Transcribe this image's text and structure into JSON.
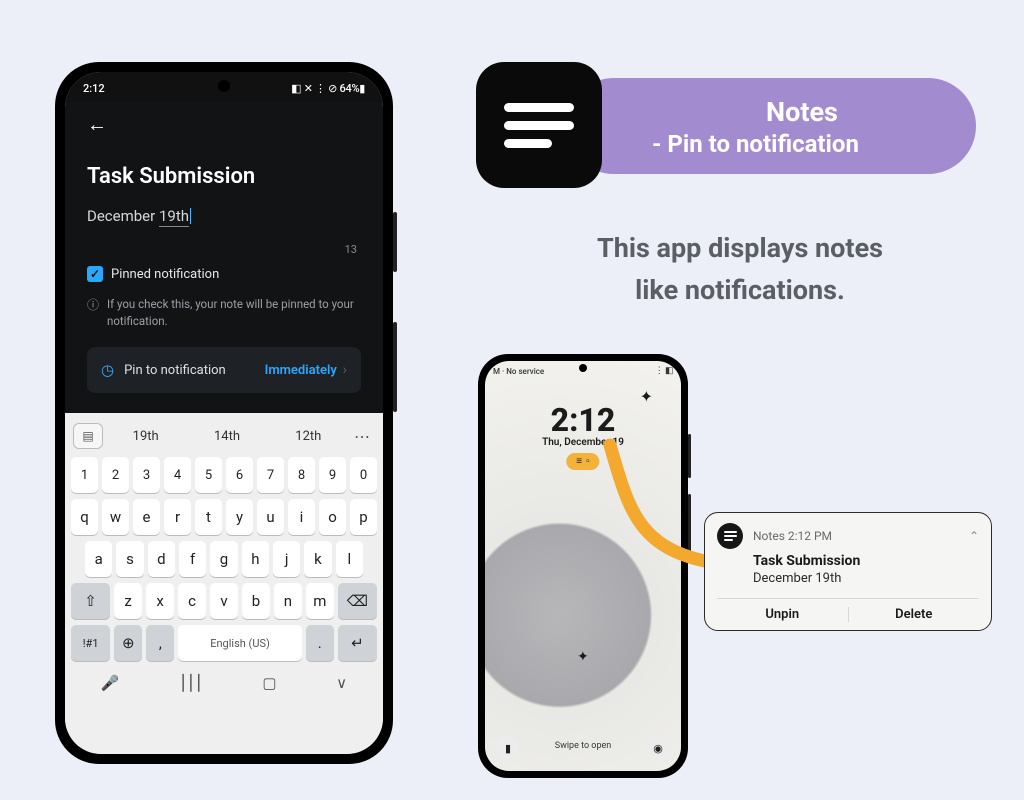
{
  "badge": {
    "line1": "Notes",
    "line2": "- Pin to notification"
  },
  "tagline_line1": "This app displays notes",
  "tagline_line2": "like notifications.",
  "phone_left": {
    "status": {
      "time": "2:12",
      "indicators": "◧ ✕ ⋮ ⊘ 64%▮"
    },
    "note": {
      "title": "Task Submission",
      "body_prefix": "December ",
      "body_underlined": "19th",
      "char_count": "13",
      "checkbox_label": "Pinned notification",
      "hint": "If you check this, your note will be pinned to your notification.",
      "pin_label": "Pin to notification",
      "pin_when": "Immediately"
    },
    "keyboard": {
      "suggestions": [
        "19th",
        "14th",
        "12th"
      ],
      "row_num": [
        "1",
        "2",
        "3",
        "4",
        "5",
        "6",
        "7",
        "8",
        "9",
        "0"
      ],
      "row1": [
        "q",
        "w",
        "e",
        "r",
        "t",
        "y",
        "u",
        "i",
        "o",
        "p"
      ],
      "row2": [
        "a",
        "s",
        "d",
        "f",
        "g",
        "h",
        "j",
        "k",
        "l"
      ],
      "row3": [
        "z",
        "x",
        "c",
        "v",
        "b",
        "n",
        "m"
      ],
      "shift": "⇧",
      "backspace": "⌫",
      "sym": "!#1",
      "globe": "⊕",
      "comma": ",",
      "space_label": "English (US)",
      "period": ".",
      "enter": "↵",
      "nav": {
        "mic": "🎤",
        "recents": "⎮⎮⎮",
        "home": "▢",
        "back": "∨"
      }
    }
  },
  "phone_right": {
    "carrier": "M · No service",
    "status_r": "⋮ ◧",
    "clock": "2:12",
    "date": "Thu, December 19",
    "swipe": "Swipe to open",
    "flash": "▮",
    "cam": "◉"
  },
  "notif": {
    "app": "Notes",
    "time": "2:12 PM",
    "title": "Task Submission",
    "body": "December 19th",
    "actions": {
      "unpin": "Unpin",
      "delete": "Delete"
    }
  }
}
